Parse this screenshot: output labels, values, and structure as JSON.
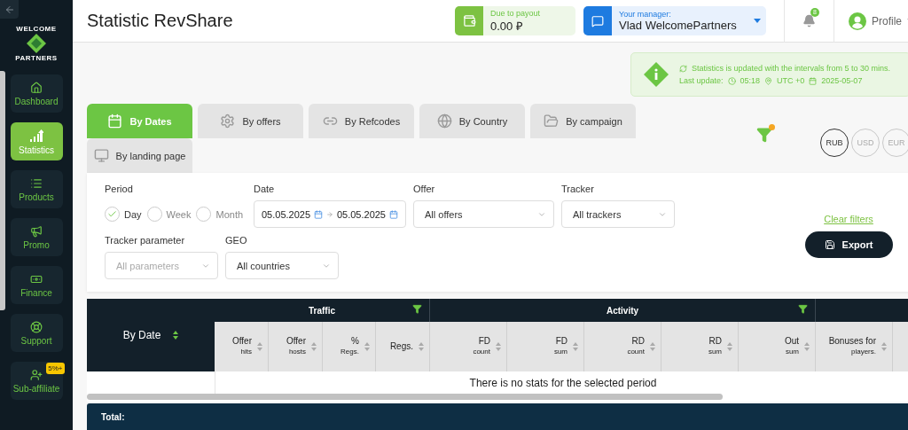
{
  "logo": {
    "top": "WELCOME",
    "bottom": "PARTNERS"
  },
  "sidebar": {
    "items": [
      {
        "label": "Dashboard",
        "selected": false
      },
      {
        "label": "Statistics",
        "selected": true
      },
      {
        "label": "Products",
        "selected": false
      },
      {
        "label": "Promo",
        "selected": false
      },
      {
        "label": "Finance",
        "selected": false
      },
      {
        "label": "Support",
        "selected": false
      },
      {
        "label": "Sub-affiliate",
        "selected": false,
        "badge": "5%+"
      }
    ]
  },
  "header": {
    "title": "Statistic RevShare",
    "payout": {
      "label": "Due to payout",
      "value": "0.00 ₽"
    },
    "manager": {
      "label": "Your manager:",
      "name": "Vlad WelcomePartners"
    },
    "notifications": "8",
    "profile": "Profile"
  },
  "info": {
    "line1": "Statistics is updated with the intervals from 5 to 30 mins.",
    "last_update_label": "Last update:",
    "time": "05:18",
    "zone": "UTC +0",
    "date": "2025-05-07"
  },
  "tabs": [
    {
      "label": "By Dates",
      "selected": true
    },
    {
      "label": "By offers",
      "selected": false
    },
    {
      "label": "By Refcodes",
      "selected": false
    },
    {
      "label": "By Country",
      "selected": false
    },
    {
      "label": "By campaign",
      "selected": false
    },
    {
      "label": "By landing page",
      "selected": false
    }
  ],
  "currencies": [
    {
      "label": "RUB",
      "selected": true
    },
    {
      "label": "USD",
      "selected": false
    },
    {
      "label": "EUR",
      "selected": false
    }
  ],
  "filters": {
    "period_label": "Period",
    "periods": [
      {
        "label": "Day",
        "selected": true
      },
      {
        "label": "Week",
        "selected": false
      },
      {
        "label": "Month",
        "selected": false
      }
    ],
    "date_label": "Date",
    "date_from": "05.05.2025",
    "date_to": "05.05.2025",
    "offer_label": "Offer",
    "offer_value": "All offers",
    "tracker_label": "Tracker",
    "tracker_value": "All trackers",
    "tracker_param_label": "Tracker parameter",
    "tracker_param_placeholder": "All parameters",
    "geo_label": "GEO",
    "geo_value": "All countries",
    "clear": "Clear filters",
    "export": "Export"
  },
  "table": {
    "first_column": "By Date",
    "groups": [
      {
        "label": "Traffic",
        "columns": [
          {
            "title": "Offer",
            "sub": "hits"
          },
          {
            "title": "Offer",
            "sub": "hosts"
          },
          {
            "title": "%",
            "sub": "Regs."
          },
          {
            "title": "Regs."
          }
        ]
      },
      {
        "label": "Activity",
        "columns": [
          {
            "title": "FD",
            "sub": "count"
          },
          {
            "title": "FD",
            "sub": "sum"
          },
          {
            "title": "RD",
            "sub": "count"
          },
          {
            "title": "RD",
            "sub": "sum"
          },
          {
            "title": "Out",
            "sub": "sum"
          }
        ]
      },
      {
        "columns": [
          {
            "title": "Bonuses for",
            "sub": "players."
          }
        ]
      }
    ],
    "empty": "There is no stats for the selected period",
    "total": "Total:"
  }
}
